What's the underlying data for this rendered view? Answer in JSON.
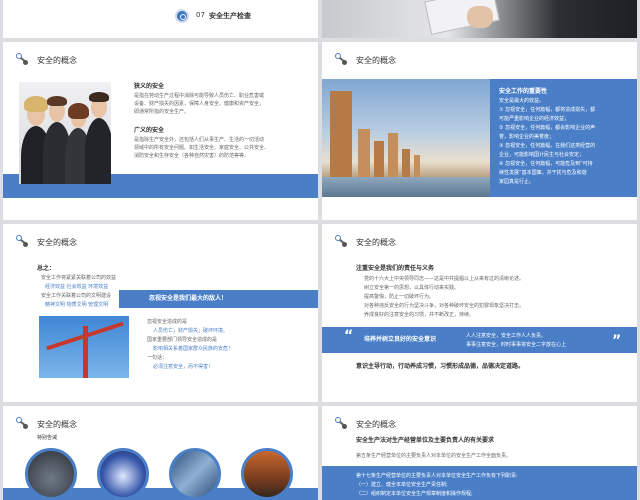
{
  "colors": {
    "accent": "#4a7fc8",
    "background": "#dcdde0"
  },
  "slide1": {
    "number": "07",
    "title": "安全生产检查"
  },
  "slide3": {
    "header": "安全的概念",
    "narrow_title": "狭义的安全",
    "narrow_lines": [
      "是指在劳动生产过程中消除可能导致人员伤亡、职业危害或",
      "设备、财产损失的因素，保障人身安全、健康和资产安全，",
      "即通常所指的安全生产。"
    ],
    "broad_title": "广义的安全",
    "broad_lines": [
      "是指除生产安全外，还包括人们从事生产、生活的一切活动",
      "领域中的所有安全问题。如生活安全、家庭安全、公共安全、",
      "消防安全和生存安全（各种自然灾害）的防范等等。"
    ]
  },
  "slide4": {
    "header": "安全的概念",
    "title": "安全工作的重要性",
    "lines": [
      "安全是最大的效益。",
      "① 忽视安全，任何篇幅，都将造成损失，都",
      "可能严重影响企业的经济效益；",
      "② 忽视安全，任何篇幅，都会影响企业的声",
      "誉，影响企业的美誉度；",
      "③ 忽视安全，任何篇幅，在我们这类经营的",
      "企业，可能影响国计民生与社会安定；",
      "④ 忽视安全，任何篇幅，可能危及到“可持",
      "续性发展”基本国策，并干扰与危及和谐",
      "家园真是行止。"
    ]
  },
  "slide5": {
    "header": "安全的概念",
    "summary_title": "总之：",
    "summary_lines": [
      "安全工作将紧紧关联着公司的效益",
      "经济效益  社会效益  环境效益",
      "安全工作关联着公司的文明建设",
      "精神文明  物质文明  管理文明"
    ],
    "banner": "忽视安全是我们最大的敌人！",
    "items": [
      "忽视安全造成的是",
      "人员伤亡；财产损失；破坏环境。",
      "国家重要部门领导安全造成的是",
      "影响相关系着国家群众民族的安危！",
      "一句话：",
      "必须注意安全，而不得害！"
    ]
  },
  "slide6": {
    "header": "安全的概念",
    "title": "注重安全是我们的责任与义务",
    "lines": [
      "党的十六大上中央领导同志——这是中共提倡以上从来有过的清晰论述。",
      "树立安全第一的思想，以具体行动来实践。",
      "提高警惕，防止一切破坏行为。",
      "对各种违反安全的行为坚决斗争，对各种破坏安全的犯罪现象坚决打击。",
      "养成良好的注意安全的习惯，并不断改正，持续。"
    ],
    "banner_left": "培养并树立良好的安全意识",
    "banner_right": [
      "人人注意安全，安全工作人人负责。",
      "事事注意安全，时时事事将安全二字放在心上"
    ],
    "footer": "意识主导行动，行动养成习惯，习惯形成品德，品德决定道路。"
  },
  "slide7": {
    "header": "安全的概念",
    "subtitle": "特别告诫"
  },
  "slide8": {
    "header": "安全的概念",
    "title": "安全生产法对生产经营单位及主要负责人的有关要求",
    "line1": "第五条生产经营单位的主要负责人对本单位的安全生产工作全面负责。",
    "article": "第十七条生产经营单位的主要负责人对本单位安全生产工作负有下列职责:",
    "clauses": [
      "（一）建立、健全本单位安全生产责任制;",
      "（二）组织制定本单位安全生产规章制度和操作规程;"
    ]
  }
}
